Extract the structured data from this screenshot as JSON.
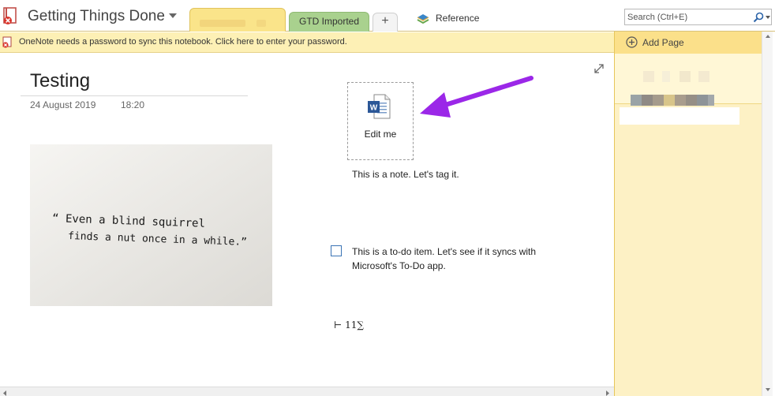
{
  "header": {
    "notebook_title": "Getting Things Done",
    "tabs": [
      {
        "label": "",
        "active": true
      },
      {
        "label": "GTD Imported",
        "active": false
      }
    ],
    "add_tab_label": "+",
    "reference_label": "Reference",
    "search_placeholder": "Search (Ctrl+E)"
  },
  "notification": {
    "text": "OneNote needs a password to sync this notebook. Click here to enter your password."
  },
  "page": {
    "title": "Testing",
    "date": "24 August 2019",
    "time": "18:20",
    "image_quote_line1": "“ Even a blind squirrel",
    "image_quote_line2": "finds a nut once in a while.”",
    "attachment_label": "Edit me",
    "note_text": "This is a note. Let's tag it.",
    "todo_text": "This is a to-do item. Let's see if it syncs with Microsoft's To-Do app.",
    "formula_text": "⊢ 11∑"
  },
  "pane": {
    "add_page_label": "Add Page"
  },
  "colors": {
    "section_tab": "#fae48a",
    "gtd_tab": "#a9d18e",
    "notification_bg": "#fdf0b5",
    "pane_bg": "#fdf1c5",
    "arrow": "#9b27e8",
    "word_blue": "#2b5797"
  },
  "icons": {
    "notebook": "notebook-sync-error-icon",
    "reference": "reference-notebook-icon",
    "search": "magnifier-icon",
    "warning": "sync-error-icon",
    "attachment": "word-document-icon",
    "expand": "expand-icon",
    "add_page": "plus-circle-icon"
  }
}
